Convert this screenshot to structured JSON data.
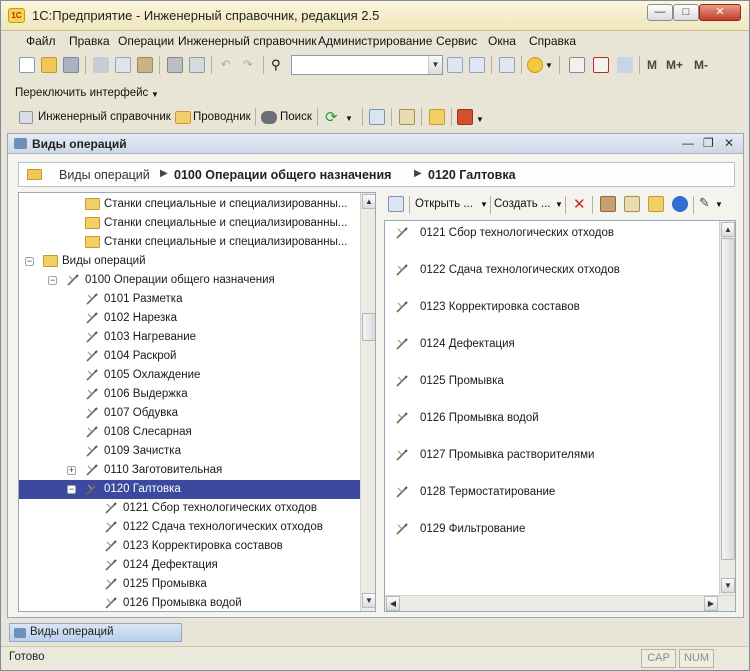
{
  "window": {
    "title": "1С:Предприятие - Инженерный справочник, редакция 2.5",
    "icon_label": "1С",
    "controls": [
      "minimize",
      "maximize",
      "close"
    ]
  },
  "menu": {
    "items": [
      {
        "label": "Файл"
      },
      {
        "label": "Правка"
      },
      {
        "label": "Операции"
      },
      {
        "label": "Инженерный справочник"
      },
      {
        "label": "Администрирование"
      },
      {
        "label": "Сервис"
      },
      {
        "label": "Окна"
      },
      {
        "label": "Справка"
      }
    ]
  },
  "toolbar_main": {
    "search_value": "",
    "m_buttons": [
      "M",
      "M+",
      "M-"
    ]
  },
  "toolbar_interface": {
    "switch_label": "Переключить интерфейс"
  },
  "toolbar_nav": {
    "engineering_ref_label": "Инженерный справочник",
    "explorer_label": "Проводник",
    "search_label": "Поиск"
  },
  "form": {
    "title": "Виды операций",
    "breadcrumb": [
      "Виды операций",
      "0100 Операции общего назначения",
      "0120 Галтовка"
    ]
  },
  "tree": {
    "rows": [
      {
        "label": "Станки специальные и специализированны...",
        "icon": "folder-icon",
        "indent": 2,
        "expander": ""
      },
      {
        "label": "Станки специальные и специализированны...",
        "icon": "folder-icon",
        "indent": 2,
        "expander": ""
      },
      {
        "label": "Станки специальные и специализированны...",
        "icon": "folder-icon",
        "indent": 2,
        "expander": ""
      },
      {
        "label": "Виды операций",
        "icon": "folder-icon",
        "indent": 0,
        "expander": "−"
      },
      {
        "label": "0100 Операции общего назначения",
        "icon": "tool-icon",
        "indent": 1,
        "expander": "−"
      },
      {
        "label": "0101 Разметка",
        "icon": "tool-icon",
        "indent": 2,
        "expander": ""
      },
      {
        "label": "0102 Нарезка",
        "icon": "tool-icon",
        "indent": 2,
        "expander": ""
      },
      {
        "label": "0103 Нагревание",
        "icon": "tool-icon",
        "indent": 2,
        "expander": ""
      },
      {
        "label": "0104 Раскрой",
        "icon": "tool-icon",
        "indent": 2,
        "expander": ""
      },
      {
        "label": "0105 Охлаждение",
        "icon": "tool-icon",
        "indent": 2,
        "expander": ""
      },
      {
        "label": "0106 Выдержка",
        "icon": "tool-icon",
        "indent": 2,
        "expander": ""
      },
      {
        "label": "0107 Обдувка",
        "icon": "tool-icon",
        "indent": 2,
        "expander": ""
      },
      {
        "label": "0108 Слесарная",
        "icon": "tool-icon",
        "indent": 2,
        "expander": ""
      },
      {
        "label": "0109 Зачистка",
        "icon": "tool-icon",
        "indent": 2,
        "expander": ""
      },
      {
        "label": "0110 Заготовительная",
        "icon": "tool-icon",
        "indent": 2,
        "expander": "+"
      },
      {
        "label": "0120 Галтовка",
        "icon": "tool-icon",
        "indent": 2,
        "expander": "−",
        "selected": true
      },
      {
        "label": "0121 Сбор технологических отходов",
        "icon": "tool-icon",
        "indent": 3,
        "expander": ""
      },
      {
        "label": "0122 Сдача технологических отходов",
        "icon": "tool-icon",
        "indent": 3,
        "expander": ""
      },
      {
        "label": "0123 Корректировка составов",
        "icon": "tool-icon",
        "indent": 3,
        "expander": ""
      },
      {
        "label": "0124 Дефектация",
        "icon": "tool-icon",
        "indent": 3,
        "expander": ""
      },
      {
        "label": "0125 Промывка",
        "icon": "tool-icon",
        "indent": 3,
        "expander": ""
      },
      {
        "label": "0126 Промывка водой",
        "icon": "tool-icon",
        "indent": 3,
        "expander": ""
      }
    ]
  },
  "list_toolbar": {
    "open_label": "Открыть ...",
    "create_label": "Создать ..."
  },
  "list": {
    "items": [
      "0121 Сбор технологических отходов",
      "0122 Сдача технологических отходов",
      "0123 Корректировка составов",
      "0124 Дефектация",
      "0125 Промывка",
      "0126 Промывка водой",
      "0127 Промывка растворителями",
      "0128 Термостатирование",
      "0129 Фильтрование"
    ]
  },
  "taskbar": {
    "tab_label": "Виды операций"
  },
  "status": {
    "text": "Готово",
    "indicators": [
      "CAP",
      "NUM"
    ]
  },
  "colors": {
    "selection": "#3b4a9e",
    "folder": "#f3cf67",
    "title_gradient_top": "#fbf6dc"
  }
}
